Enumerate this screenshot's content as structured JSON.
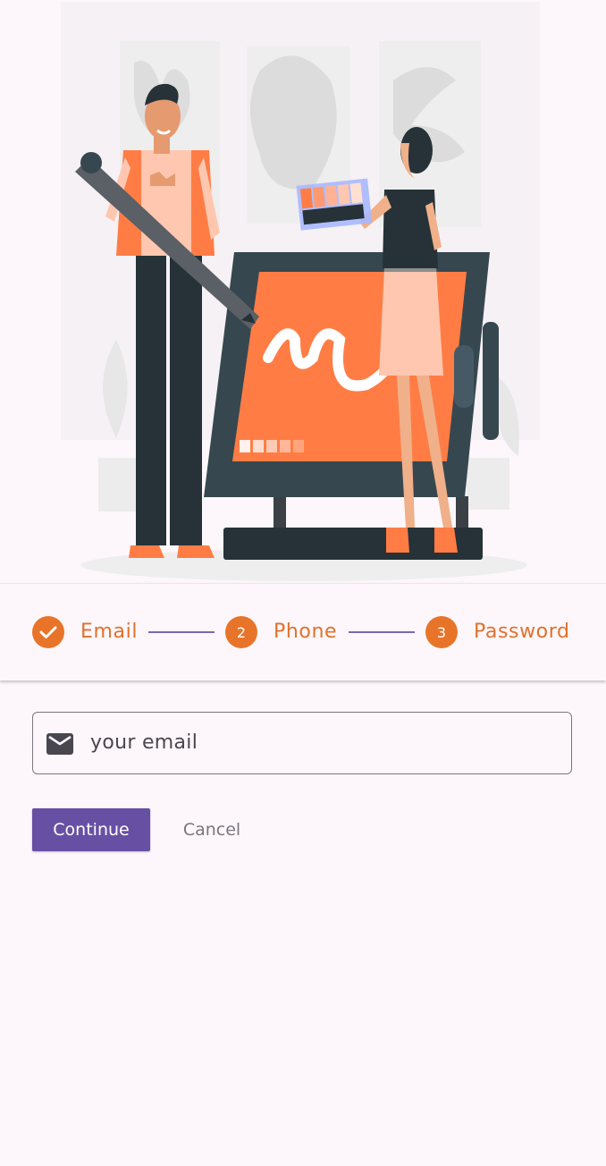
{
  "stepper": {
    "steps": [
      {
        "label": "Email",
        "number": "",
        "state": "completed",
        "icon": "check-icon"
      },
      {
        "label": "Phone",
        "number": "2",
        "state": "pending"
      },
      {
        "label": "Password",
        "number": "3",
        "state": "pending"
      }
    ]
  },
  "form": {
    "email_placeholder": "your email",
    "email_icon": "mail-icon"
  },
  "actions": {
    "continue_label": "Continue",
    "cancel_label": "Cancel"
  },
  "colors": {
    "accent": "#e8742a",
    "primary": "#6750a4",
    "background": "#fdf7fc"
  }
}
